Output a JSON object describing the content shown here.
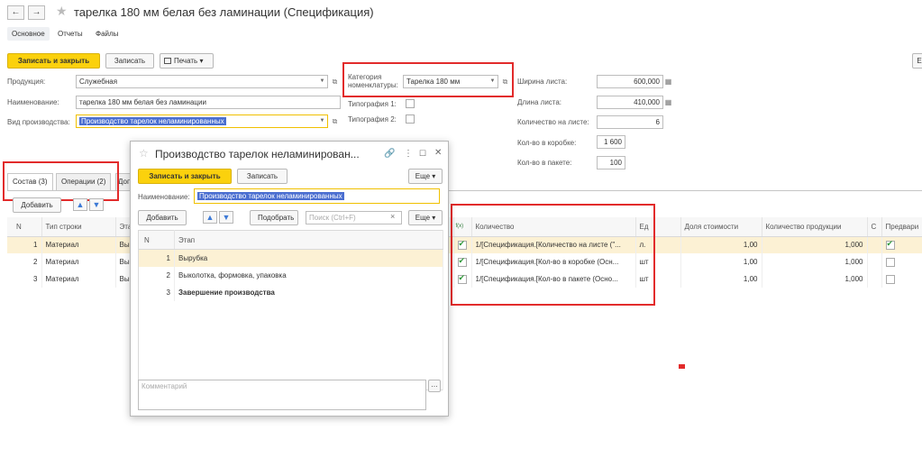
{
  "window": {
    "title": "тарелка 180 мм белая без ламинации (Спецификация)",
    "back_icon": "←",
    "forward_icon": "→",
    "star_icon": "★"
  },
  "subnav": {
    "main": "Основное",
    "reports": "Отчеты",
    "files": "Файлы"
  },
  "toolbar": {
    "save_close": "Записать и закрыть",
    "save": "Записать",
    "print": "Печать",
    "print_arrow": "▾",
    "right_btn": "Е"
  },
  "form": {
    "product_label": "Продукция:",
    "product_value": "Служебная",
    "name_label": "Наименование:",
    "name_value": "тарелка 180 мм белая без ламинации",
    "prodtype_label": "Вид производства:",
    "prodtype_value": "Производство тарелок неламинированных",
    "category_label_1": "Категория",
    "category_label_2": "номенклатуры:",
    "category_value": "Тарелка 180 мм",
    "typo1_label": "Типография 1:",
    "typo2_label": "Типография 2:",
    "sheet_width_label": "Ширина листа:",
    "sheet_width_value": "600,000",
    "sheet_length_label": "Длина листа:",
    "sheet_length_value": "410,000",
    "per_sheet_label": "Количество на листе:",
    "per_sheet_value": "6",
    "per_box_label": "Кол-во в коробке:",
    "per_box_value": "1 600",
    "per_pack_label": "Кол-во в пакете:",
    "per_pack_value": "100"
  },
  "tabs": {
    "composition": "Состав (3)",
    "operations": "Операции (2)",
    "third": "Доп"
  },
  "main_table": {
    "add_button": "Добавить",
    "headers": {
      "n": "N",
      "row_type": "Тип строки",
      "stage": "Эта",
      "fx": "f(x)",
      "quantity": "Количество",
      "unit": "Ед",
      "cost_share": "Доля стоимости",
      "product_qty": "Количество продукции",
      "c": "С",
      "prelim": "Предвари"
    },
    "rows": [
      {
        "n": "1",
        "type": "Материал",
        "stage": "Вы",
        "quantity": "1/[Спецификация.[Количество на листе (\"...",
        "unit": "л.",
        "cost_share": "1,00",
        "product_qty": "1,000",
        "checked": true,
        "prelim": true
      },
      {
        "n": "2",
        "type": "Материал",
        "stage": "Вы",
        "quantity": "1/[Спецификация.[Кол-во в коробке (Осн...",
        "unit": "шт",
        "cost_share": "1,00",
        "product_qty": "1,000",
        "checked": true,
        "prelim": false
      },
      {
        "n": "3",
        "type": "Материал",
        "stage": "Вы",
        "quantity": "1/[Спецификация.[Кол-во в пакете (Осно...",
        "unit": "шт",
        "cost_share": "1,00",
        "product_qty": "1,000",
        "checked": true,
        "prelim": false
      }
    ]
  },
  "dialog": {
    "title": "Производство тарелок неламинирован...",
    "save_close": "Записать и закрыть",
    "save": "Записать",
    "more": "Еще",
    "name_label": "Наименование:",
    "name_value": "Производство тарелок неламинированных",
    "add": "Добавить",
    "pick": "Подобрать",
    "search_placeholder": "Поиск (Ctrl+F)",
    "col_n": "N",
    "col_stage": "Этап",
    "rows": [
      {
        "n": "1",
        "stage": "Вырубка"
      },
      {
        "n": "2",
        "stage": "Выколотка, формовка, упаковка"
      },
      {
        "n": "3",
        "stage": "Завершение производства"
      }
    ],
    "comment_placeholder": "Комментарий"
  }
}
